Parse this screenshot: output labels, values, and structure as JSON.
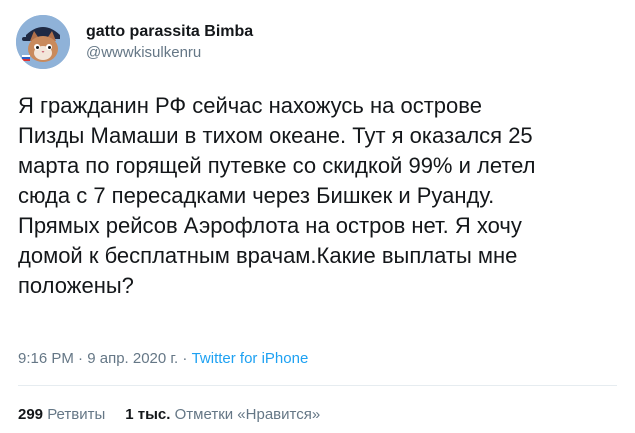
{
  "author": {
    "display_name": "gatto parassita Bimba",
    "handle": "@wwwkisulkenru",
    "avatar": "cartoon-cat-avatar"
  },
  "tweet": {
    "text": "Я гражданин РФ сейчас нахожусь на острове\nПизды Мамаши в тихом океане. Тут я оказался 25\nмарта по горящей путевке со скидкой 99% и летел\nсюда с 7 пересадками через Бишкек и Руанду.\nПрямых рейсов Аэрофлота на остров нет. Я хочу\nдомой к бесплатным врачам.Какие выплаты мне\nположены?",
    "time": "9:16 PM",
    "separator": " · ",
    "date": "9 апр. 2020 г.",
    "source": "Twitter for iPhone"
  },
  "stats": {
    "retweets_count": "299",
    "retweets_label": "Ретвиты",
    "likes_count": "1 тыс.",
    "likes_label": "Отметки «Нравится»"
  },
  "colors": {
    "text": "#14171a",
    "secondary": "#657786",
    "link": "#1da1f2",
    "divider": "#e6ecf0"
  }
}
